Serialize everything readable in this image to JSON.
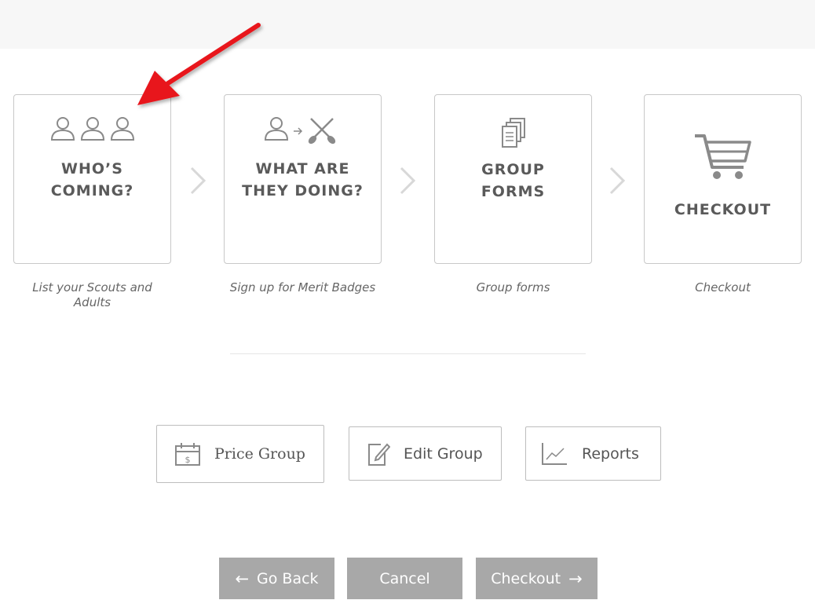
{
  "steps": [
    {
      "title": "WHO’S\nCOMING?",
      "caption": "List your Scouts and Adults",
      "icon": "three-people-icon"
    },
    {
      "title": "WHAT ARE\nTHEY DOING?",
      "caption": "Sign up for Merit Badges",
      "icon": "person-to-paddles-icon"
    },
    {
      "title": "GROUP\nFORMS",
      "caption": "Group forms",
      "icon": "documents-icon"
    },
    {
      "title": "CHECKOUT",
      "caption": "Checkout",
      "icon": "shopping-cart-icon"
    }
  ],
  "actions": {
    "price_group": {
      "label": "Price Group",
      "icon": "calendar-dollar-icon"
    },
    "edit_group": {
      "label": "Edit Group",
      "icon": "edit-note-icon"
    },
    "reports": {
      "label": "Reports",
      "icon": "line-chart-icon"
    }
  },
  "nav": {
    "go_back": "Go Back",
    "cancel": "Cancel",
    "checkout": "Checkout",
    "arrow_left": "←",
    "arrow_right": "→"
  },
  "colors": {
    "annotation_arrow": "#e8161b",
    "nav_button_bg": "#a8a8a8",
    "card_border": "#c8c8c8",
    "icon_gray": "#8a8a8a"
  }
}
